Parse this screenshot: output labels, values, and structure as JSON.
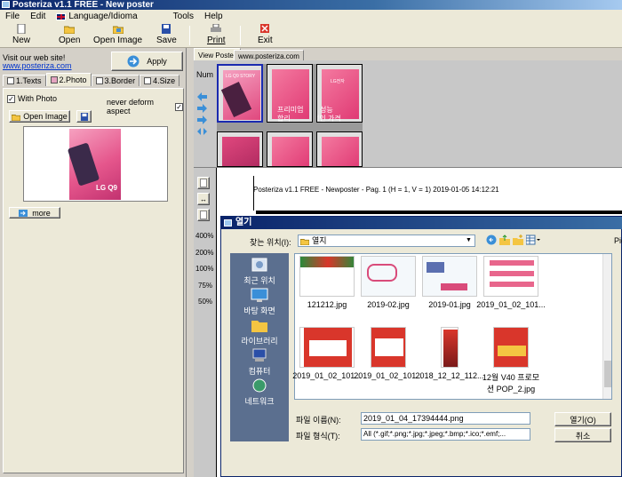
{
  "window": {
    "title": "Posteriza v1.1 FREE - New poster"
  },
  "menu": {
    "items": [
      "File",
      "Edit",
      "Language/Idioma",
      "Tools",
      "Help"
    ]
  },
  "toolbar": {
    "new": "New",
    "open": "Open",
    "open_image": "Open Image",
    "save": "Save",
    "print": "Print",
    "exit": "Exit"
  },
  "left": {
    "visit_text": "Visit our web site!",
    "site_link": "www.posteriza.com",
    "apply_label": "Apply",
    "tabs": [
      "1.Texts",
      "2.Photo",
      "3.Border",
      "4.Size"
    ],
    "with_photo_label": "With Photo",
    "never_deform_label": "never deform aspect",
    "open_image_label": "Open Image",
    "more_label": "more",
    "preview_text": "LG Q9"
  },
  "view": {
    "tabs": [
      "View Poster",
      "www.posteriza.com"
    ],
    "num_label": "Num",
    "zoom_levels": [
      "400%",
      "200%",
      "100%",
      "75%",
      "50%"
    ],
    "tile_texts": {
      "brand": "LG Q9 STORY",
      "lg": "LG전자",
      "line1": "프리미엄",
      "line2": "성능",
      "line3": "합리",
      "line4": "적인 가격"
    }
  },
  "printout": {
    "header": "Posteriza v1.1 FREE - Newposter - Pag. 1 (H = 1, V = 1) 2019-01-05  14:12:21"
  },
  "dialog": {
    "title": "열기",
    "look_in_label": "찾는 위치(I):",
    "look_in_value": "열지",
    "places": [
      "최근 위치",
      "바탕 화면",
      "라이브러리",
      "컴퓨터",
      "네트워크"
    ],
    "files": [
      {
        "name": "121212.jpg"
      },
      {
        "name": "2019-02.jpg"
      },
      {
        "name": "2019-01.jpg"
      },
      {
        "name": "2019_01_02_101..."
      },
      {
        "name": "2019_01_02_101..."
      },
      {
        "name": "2019_01_02_101..."
      },
      {
        "name": "2018_12_12_112..."
      },
      {
        "name": "12월 V40 프로모션 POP_2.jpg"
      }
    ],
    "filename_label": "파일 이름(N):",
    "filename_value": "2019_01_04_17394444.png",
    "filetype_label": "파일 형식(T):",
    "filetype_value": "All (*.gif;*.png;*.jpg;*.jpeg;*.bmp;*.ico;*.emf;...",
    "open_button": "열기(O)",
    "cancel_button": "취소",
    "side_label": "Pic"
  },
  "colors": {
    "accent": "#0a246a",
    "pink": "#e03a74"
  }
}
